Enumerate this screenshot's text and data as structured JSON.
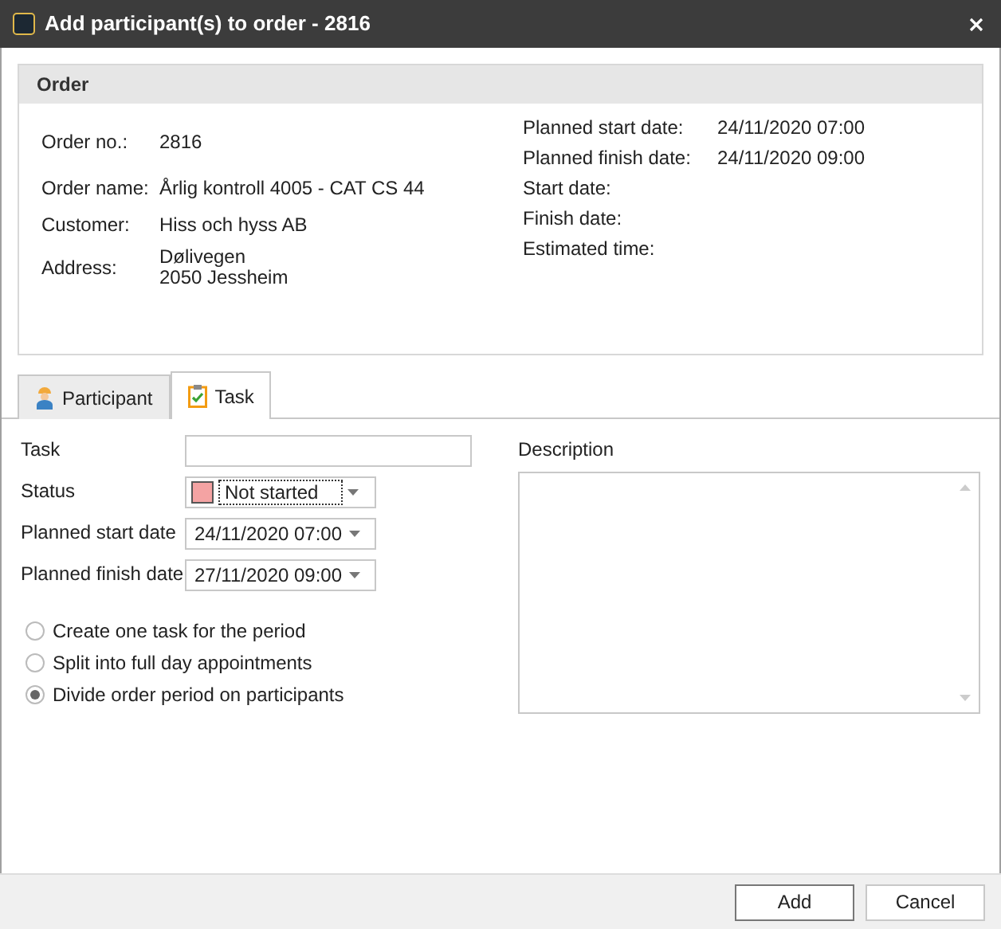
{
  "window": {
    "title": "Add participant(s) to order - 2816"
  },
  "order": {
    "title": "Order",
    "left_fields": [
      {
        "label": "Order no.:",
        "lines": [
          "2816"
        ]
      },
      {
        "label": "Order name:",
        "lines": [
          "Årlig kontroll 4005 - CAT CS 44"
        ]
      },
      {
        "label": "Customer:",
        "lines": [
          "Hiss och hyss AB"
        ]
      },
      {
        "label": "Address:",
        "lines": [
          "Dølivegen",
          "2050 Jessheim"
        ]
      }
    ],
    "right_fields": [
      {
        "label": "Planned start date:",
        "value": "24/11/2020 07:00"
      },
      {
        "label": "Planned finish date:",
        "value": "24/11/2020 09:00"
      },
      {
        "label": "Start date:"
      },
      {
        "label": "Finish date:"
      },
      {
        "label": "Estimated time:"
      }
    ]
  },
  "tabs": [
    {
      "label": "Participant",
      "kind": "person",
      "selected": false
    },
    {
      "label": "Task",
      "kind": "clipboard",
      "selected": true
    }
  ],
  "form": {
    "fields": [
      {
        "label": "Task",
        "kind": "text"
      },
      {
        "label": "Status",
        "kind": "status",
        "value": "Not started",
        "color": "#f4a3a3"
      },
      {
        "label": "Planned start date",
        "kind": "date",
        "value": "24/11/2020 07:00"
      },
      {
        "label": "Planned finish date",
        "kind": "date",
        "value": "27/11/2020 09:00"
      }
    ],
    "options": [
      {
        "label": "Create one task for the period",
        "selected": false
      },
      {
        "label": "Split into full day appointments",
        "selected": false
      },
      {
        "label": "Divide order period on participants",
        "selected": true
      }
    ],
    "description": {
      "label": "Description"
    }
  },
  "buttons": [
    {
      "label": "Add",
      "default": true
    },
    {
      "label": "Cancel",
      "default": false
    }
  ]
}
